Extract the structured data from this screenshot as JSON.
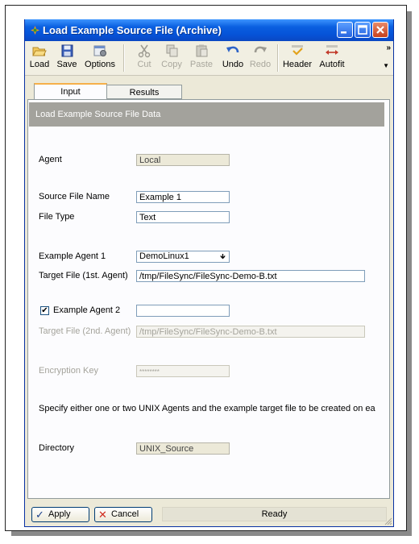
{
  "window": {
    "title": "Load Example Source File (Archive)"
  },
  "toolbar": {
    "load": "Load",
    "save": "Save",
    "options": "Options",
    "cut": "Cut",
    "copy": "Copy",
    "paste": "Paste",
    "undo": "Undo",
    "redo": "Redo",
    "header": "Header",
    "autofit": "Autofit",
    "more": "»"
  },
  "tabs": {
    "input": "Input",
    "results": "Results"
  },
  "section": {
    "header": "Load Example Source File Data"
  },
  "form": {
    "agent_label": "Agent",
    "agent_value": "Local",
    "source_file_name_label": "Source File Name",
    "source_file_name_value": "Example 1",
    "file_type_label": "File Type",
    "file_type_value": "Text",
    "example_agent1_label": "Example Agent 1",
    "example_agent1_value": "DemoLinux1",
    "target_file1_label": "Target File (1st. Agent)",
    "target_file1_value": "/tmp/FileSync/FileSync-Demo-B.txt",
    "example_agent2_label": "Example Agent 2",
    "example_agent2_checked": "✔",
    "example_agent2_value": "",
    "target_file2_label": "Target File (2nd. Agent)",
    "target_file2_value": "/tmp/FileSync/FileSync-Demo-B.txt",
    "encryption_key_label": "Encryption Key",
    "encryption_key_value": "********",
    "note": "Specify either one or two UNIX Agents and the example target file to be created on ea",
    "directory_label": "Directory",
    "directory_value": "UNIX_Source"
  },
  "footer": {
    "apply": "Apply",
    "cancel": "Cancel",
    "status": "Ready"
  },
  "colors": {
    "title_bar": "#0653d8",
    "header_band": "#a3a29c",
    "window_bg": "#ece9d8",
    "tab_highlight": "#f6b04a"
  }
}
